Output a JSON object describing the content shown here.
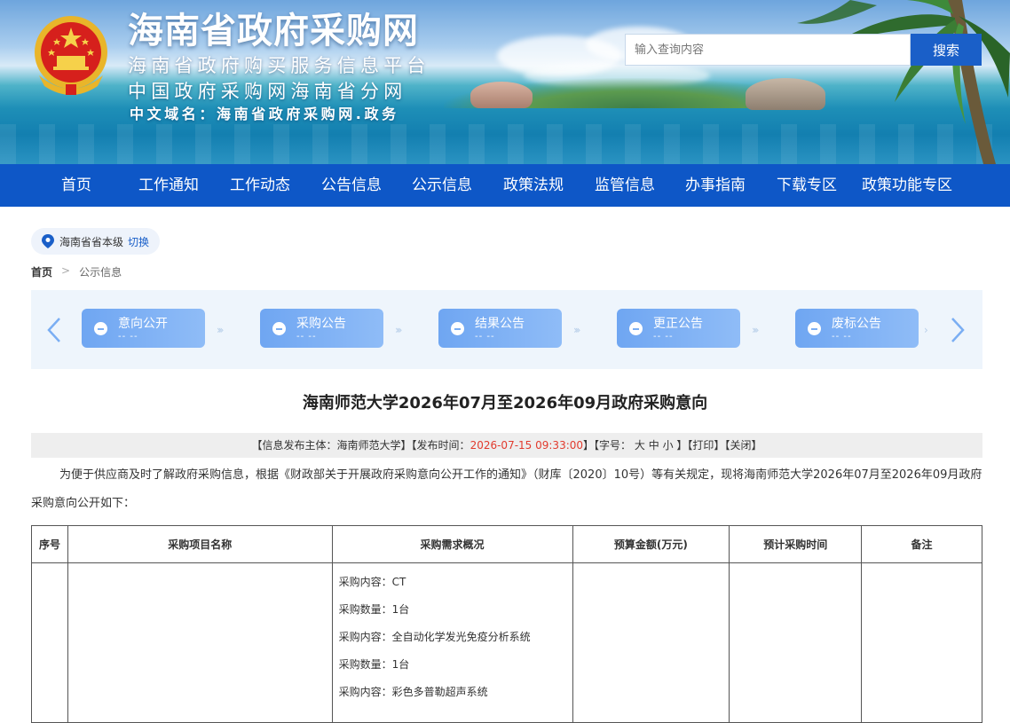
{
  "header": {
    "title": "海南省政府采购网",
    "subtitle_1": "海南省政府购买服务信息平台",
    "subtitle_2": "中国政府采购网海南省分网",
    "domain_line": "中文域名：海南省政府采购网.政务",
    "search": {
      "placeholder": "输入查询内容",
      "button_label": "搜索"
    }
  },
  "nav": {
    "items": [
      "首页",
      "工作通知",
      "工作动态",
      "公告信息",
      "公示信息",
      "政策法规",
      "监管信息",
      "办事指南",
      "下载专区",
      "政策功能专区"
    ]
  },
  "region": {
    "name": "海南省省本级",
    "switch_label": "切换"
  },
  "breadcrumb": {
    "home": "首页",
    "separator": ">",
    "current": "公示信息"
  },
  "steps": [
    {
      "title": "意向公开",
      "date": "-- --"
    },
    {
      "title": "采购公告",
      "date": "-- --"
    },
    {
      "title": "结果公告",
      "date": "-- --"
    },
    {
      "title": "更正公告",
      "date": "-- --"
    },
    {
      "title": "废标公告",
      "date": "-- --"
    }
  ],
  "article": {
    "title": "海南师范大学2026年07月至2026年09月政府采购意向",
    "meta": {
      "publisher_label": "【信息发布主体：海南师范大学】",
      "time_label": "【发布时间：",
      "time": "2026-07-15 09:33:00",
      "time_close": "】",
      "font_label": "【字号：",
      "font_large": "大",
      "font_medium": "中",
      "font_small": "小",
      "font_close": "】",
      "print": "【打印】",
      "close": "【关闭】"
    },
    "intro": "为便于供应商及时了解政府采购信息，根据《财政部关于开展政府采购意向公开工作的通知》（财库〔2020〕10号）等有关规定，现将海南师范大学2026年07月至2026年09月政府采购意向公开如下："
  },
  "table": {
    "headers": [
      "序号",
      "采购项目名称",
      "采购需求概况",
      "预算金额(万元)",
      "预计采购时间",
      "备注"
    ],
    "row_1": {
      "requirements": [
        "采购内容：CT",
        "采购数量：1台",
        "采购内容：全自动化学发光免疫分析系统",
        "采购数量：1台",
        "采购内容：彩色多普勒超声系统"
      ]
    }
  },
  "colors": {
    "nav_bg": "#0e57c7",
    "search_button": "#1a5fc8",
    "step_bg": "#7aaef3",
    "time_red": "#e23b2e"
  }
}
